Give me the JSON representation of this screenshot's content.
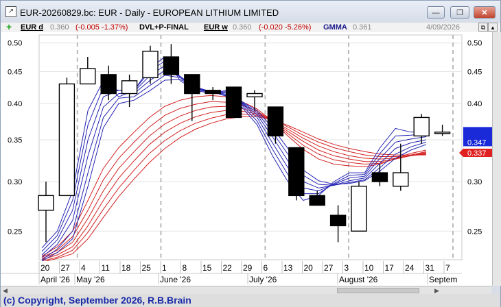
{
  "window": {
    "title": "EUR-20260829.bc: EUR - Daily - EUROPEAN LITHIUM LIMITED",
    "buttons": [
      "minimize",
      "restore",
      "close"
    ]
  },
  "legend": {
    "plus_symbol": "+",
    "daily_name": "EUR d",
    "daily_price": "0.360",
    "daily_change": "(-0.005 -1.37%)",
    "indicator_name": "DVL+P-FINAL",
    "weekly_name": "EUR w",
    "weekly_price": "0.360",
    "weekly_change": "(-0.020 -5.26%)",
    "gmma_name": "GMMA",
    "gmma_value": "0.361",
    "date": "4/09/2026"
  },
  "copyright": "(c) Copyright, September 2026, R.B.Brain",
  "colors": {
    "background": "#ffffff",
    "short_ema": "#2323b4",
    "long_ema": "#d42020",
    "candle": "#000000",
    "price_tag_blue": "#1a2ad8",
    "price_tag_red": "#e02020",
    "date_axis_text": "#000000"
  },
  "chart_data": {
    "type": "candlestick",
    "y_scale": "log",
    "ylim": [
      0.225,
      0.515
    ],
    "y_ticks": [
      0.25,
      0.3,
      0.35,
      0.4,
      0.45,
      0.5
    ],
    "y_tick_labels": [
      "0.25",
      "0.30",
      "0.35",
      "0.40",
      "0.45",
      "0.50"
    ],
    "x_ticks": [
      "20",
      "27",
      "4",
      "11",
      "18",
      "25",
      "1",
      "8",
      "15",
      "22",
      "29",
      "6",
      "13",
      "20",
      "27",
      "3",
      "10",
      "17",
      "24",
      "31",
      "7"
    ],
    "months": [
      "April '26",
      "May '26",
      "June '26",
      "July '26",
      "August '26",
      "Septem"
    ],
    "price_tags": [
      "0.347",
      "0.337"
    ],
    "candles": [
      {
        "date": "Apr 20",
        "open": 0.27,
        "high": 0.3,
        "low": 0.24,
        "close": 0.285
      },
      {
        "date": "Apr 27",
        "open": 0.285,
        "high": 0.44,
        "low": 0.285,
        "close": 0.43
      },
      {
        "date": "May 4",
        "open": 0.43,
        "high": 0.475,
        "low": 0.43,
        "close": 0.455
      },
      {
        "date": "May 11",
        "open": 0.445,
        "high": 0.46,
        "low": 0.405,
        "close": 0.415
      },
      {
        "date": "May 18",
        "open": 0.415,
        "high": 0.445,
        "low": 0.395,
        "close": 0.435
      },
      {
        "date": "May 25",
        "open": 0.44,
        "high": 0.495,
        "low": 0.43,
        "close": 0.485
      },
      {
        "date": "Jun 1",
        "open": 0.475,
        "high": 0.498,
        "low": 0.43,
        "close": 0.445
      },
      {
        "date": "Jun 8",
        "open": 0.445,
        "high": 0.445,
        "low": 0.375,
        "close": 0.415
      },
      {
        "date": "Jun 15",
        "open": 0.42,
        "high": 0.425,
        "low": 0.405,
        "close": 0.415
      },
      {
        "date": "Jun 22",
        "open": 0.425,
        "high": 0.425,
        "low": 0.38,
        "close": 0.38
      },
      {
        "date": "Jun 29",
        "open": 0.41,
        "high": 0.42,
        "low": 0.39,
        "close": 0.415
      },
      {
        "date": "Jul 6",
        "open": 0.395,
        "high": 0.395,
        "low": 0.345,
        "close": 0.355
      },
      {
        "date": "Jul 13",
        "open": 0.34,
        "high": 0.34,
        "low": 0.28,
        "close": 0.285
      },
      {
        "date": "Jul 20",
        "open": 0.285,
        "high": 0.29,
        "low": 0.275,
        "close": 0.275
      },
      {
        "date": "Jul 27",
        "open": 0.265,
        "high": 0.275,
        "low": 0.24,
        "close": 0.255
      },
      {
        "date": "Aug 3",
        "open": 0.25,
        "high": 0.3,
        "low": 0.25,
        "close": 0.295
      },
      {
        "date": "Aug 10",
        "open": 0.31,
        "high": 0.32,
        "low": 0.295,
        "close": 0.3
      },
      {
        "date": "Aug 17",
        "open": 0.295,
        "high": 0.345,
        "low": 0.29,
        "close": 0.31
      },
      {
        "date": "Aug 24",
        "open": 0.355,
        "high": 0.385,
        "low": 0.345,
        "close": 0.38
      },
      {
        "date": "Aug 31",
        "open": 0.36,
        "high": 0.37,
        "low": 0.355,
        "close": 0.36
      }
    ],
    "gmma_short_emas": [
      [
        0.235,
        0.25,
        0.29,
        0.39,
        0.435,
        0.41,
        0.42,
        0.455,
        0.475,
        0.435,
        0.42,
        0.415,
        0.42,
        0.395,
        0.37,
        0.33,
        0.3,
        0.28,
        0.285,
        0.3,
        0.31,
        0.31,
        0.34,
        0.365,
        0.36,
        0.361
      ],
      [
        0.232,
        0.246,
        0.28,
        0.37,
        0.425,
        0.42,
        0.42,
        0.45,
        0.468,
        0.44,
        0.422,
        0.416,
        0.418,
        0.398,
        0.375,
        0.338,
        0.308,
        0.287,
        0.287,
        0.298,
        0.307,
        0.308,
        0.333,
        0.355,
        0.356,
        0.358
      ],
      [
        0.229,
        0.242,
        0.27,
        0.35,
        0.41,
        0.42,
        0.418,
        0.443,
        0.46,
        0.442,
        0.423,
        0.417,
        0.416,
        0.4,
        0.38,
        0.346,
        0.316,
        0.293,
        0.29,
        0.297,
        0.304,
        0.306,
        0.327,
        0.347,
        0.351,
        0.354
      ],
      [
        0.227,
        0.238,
        0.26,
        0.33,
        0.395,
        0.415,
        0.415,
        0.435,
        0.452,
        0.442,
        0.424,
        0.418,
        0.414,
        0.401,
        0.384,
        0.354,
        0.324,
        0.3,
        0.293,
        0.296,
        0.301,
        0.304,
        0.321,
        0.339,
        0.346,
        0.35
      ],
      [
        0.225,
        0.234,
        0.25,
        0.31,
        0.38,
        0.408,
        0.41,
        0.427,
        0.444,
        0.44,
        0.425,
        0.418,
        0.412,
        0.402,
        0.387,
        0.36,
        0.332,
        0.307,
        0.297,
        0.296,
        0.299,
        0.302,
        0.316,
        0.332,
        0.341,
        0.347
      ],
      [
        0.224,
        0.231,
        0.243,
        0.295,
        0.366,
        0.4,
        0.405,
        0.419,
        0.436,
        0.437,
        0.425,
        0.418,
        0.411,
        0.403,
        0.39,
        0.366,
        0.339,
        0.313,
        0.301,
        0.297,
        0.298,
        0.301,
        0.312,
        0.327,
        0.337,
        0.344
      ]
    ],
    "gmma_long_emas": [
      [
        0.228,
        0.236,
        0.25,
        0.28,
        0.315,
        0.34,
        0.36,
        0.38,
        0.396,
        0.405,
        0.41,
        0.412,
        0.41,
        0.403,
        0.392,
        0.375,
        0.355,
        0.338,
        0.326,
        0.32,
        0.318,
        0.317,
        0.32,
        0.327,
        0.333,
        0.337
      ],
      [
        0.227,
        0.233,
        0.245,
        0.27,
        0.302,
        0.327,
        0.347,
        0.367,
        0.383,
        0.393,
        0.399,
        0.403,
        0.402,
        0.398,
        0.389,
        0.375,
        0.358,
        0.343,
        0.332,
        0.325,
        0.322,
        0.32,
        0.321,
        0.326,
        0.331,
        0.335
      ],
      [
        0.226,
        0.231,
        0.24,
        0.262,
        0.29,
        0.315,
        0.335,
        0.355,
        0.371,
        0.382,
        0.39,
        0.395,
        0.396,
        0.393,
        0.387,
        0.376,
        0.361,
        0.348,
        0.337,
        0.33,
        0.326,
        0.323,
        0.323,
        0.326,
        0.33,
        0.334
      ],
      [
        0.225,
        0.229,
        0.236,
        0.255,
        0.28,
        0.304,
        0.324,
        0.344,
        0.36,
        0.372,
        0.381,
        0.387,
        0.39,
        0.389,
        0.385,
        0.376,
        0.364,
        0.352,
        0.342,
        0.335,
        0.33,
        0.327,
        0.326,
        0.327,
        0.33,
        0.333
      ],
      [
        0.224,
        0.227,
        0.233,
        0.249,
        0.271,
        0.293,
        0.313,
        0.333,
        0.349,
        0.362,
        0.372,
        0.379,
        0.384,
        0.385,
        0.383,
        0.377,
        0.367,
        0.356,
        0.347,
        0.34,
        0.335,
        0.331,
        0.329,
        0.329,
        0.33,
        0.332
      ],
      [
        0.223,
        0.226,
        0.23,
        0.243,
        0.263,
        0.284,
        0.303,
        0.322,
        0.339,
        0.353,
        0.364,
        0.372,
        0.378,
        0.381,
        0.381,
        0.377,
        0.369,
        0.36,
        0.351,
        0.344,
        0.339,
        0.335,
        0.332,
        0.331,
        0.331,
        0.331
      ]
    ]
  }
}
